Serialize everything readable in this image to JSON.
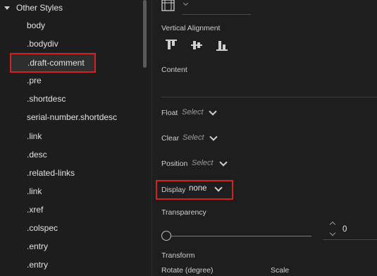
{
  "style_tree": {
    "group_label": "Other Styles",
    "items": [
      "body",
      ".bodydiv",
      ".draft-comment",
      ".pre",
      ".shortdesc",
      "serial-number.shortdesc",
      ".link",
      ".desc",
      ".related-links",
      ".link",
      ".xref",
      ".colspec",
      ".entry",
      ".entry"
    ],
    "selected_item": ".draft-comment"
  },
  "properties": {
    "vertical_alignment_label": "Vertical Alignment",
    "content_label": "Content",
    "float": {
      "label": "Float",
      "value": "Select"
    },
    "clear": {
      "label": "Clear",
      "value": "Select"
    },
    "position": {
      "label": "Position",
      "value": "Select"
    },
    "display": {
      "label": "Display",
      "value": "none"
    },
    "transparency": {
      "label": "Transparency",
      "value": "0"
    },
    "transform_label": "Transform",
    "rotate_label": "Rotate (degree)",
    "scale_label": "Scale"
  },
  "colors": {
    "highlight": "#d42222",
    "background": "#1e1e1e"
  }
}
